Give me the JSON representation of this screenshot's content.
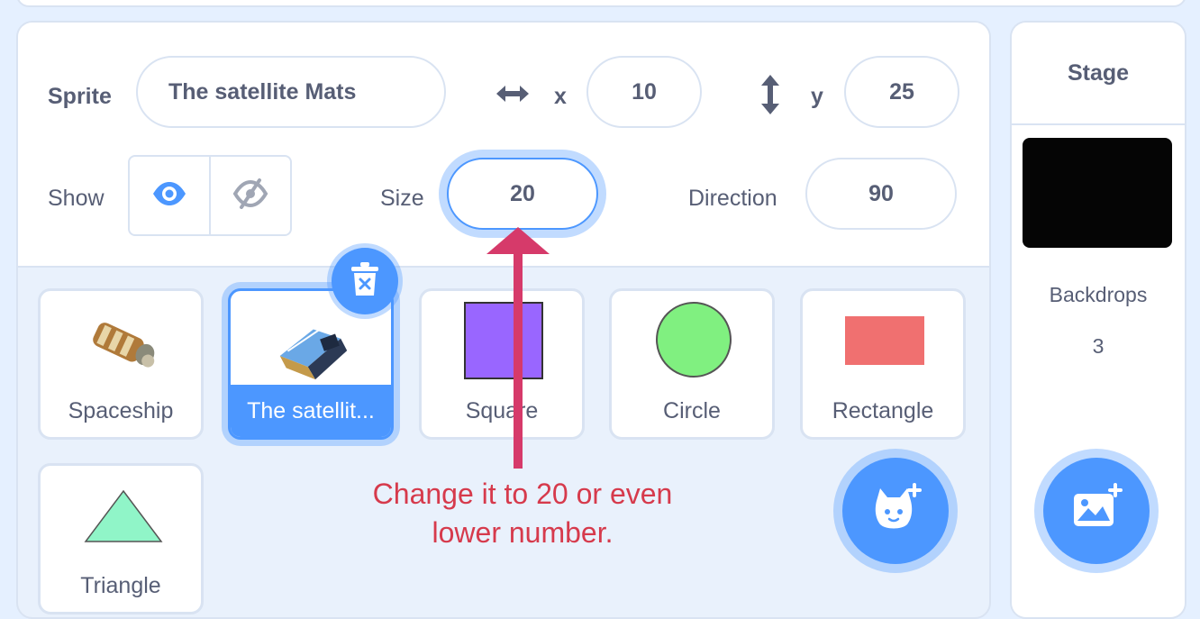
{
  "sprite_info": {
    "sprite_label": "Sprite",
    "sprite_name": "The satellite Mats",
    "x_label": "x",
    "x_value": "10",
    "y_label": "y",
    "y_value": "25",
    "show_label": "Show",
    "size_label": "Size",
    "size_value": "20",
    "direction_label": "Direction",
    "direction_value": "90",
    "visible": true
  },
  "sprites": [
    {
      "name": "Spaceship",
      "selected": false
    },
    {
      "name": "The satellit...",
      "selected": true
    },
    {
      "name": "Square",
      "selected": false
    },
    {
      "name": "Circle",
      "selected": false
    },
    {
      "name": "Rectangle",
      "selected": false
    },
    {
      "name": "Triangle",
      "selected": false
    }
  ],
  "annotation": {
    "line1": "Change it to 20 or even",
    "line2": "lower number."
  },
  "stage": {
    "title": "Stage",
    "backdrops_label": "Backdrops",
    "backdrops_count": "3"
  },
  "colors": {
    "accent": "#4c97ff",
    "annotation": "#d63a4c",
    "square": "#9966ff",
    "circle": "#80f080",
    "rectangle": "#f07070",
    "triangle": "#90f5c8"
  },
  "icons": {
    "show": "eye-icon",
    "hide": "eye-off-icon",
    "x": "horizontal-arrows-icon",
    "y": "vertical-arrows-icon",
    "delete": "trash-icon",
    "add_sprite": "cat-plus-icon",
    "add_backdrop": "image-plus-icon"
  }
}
